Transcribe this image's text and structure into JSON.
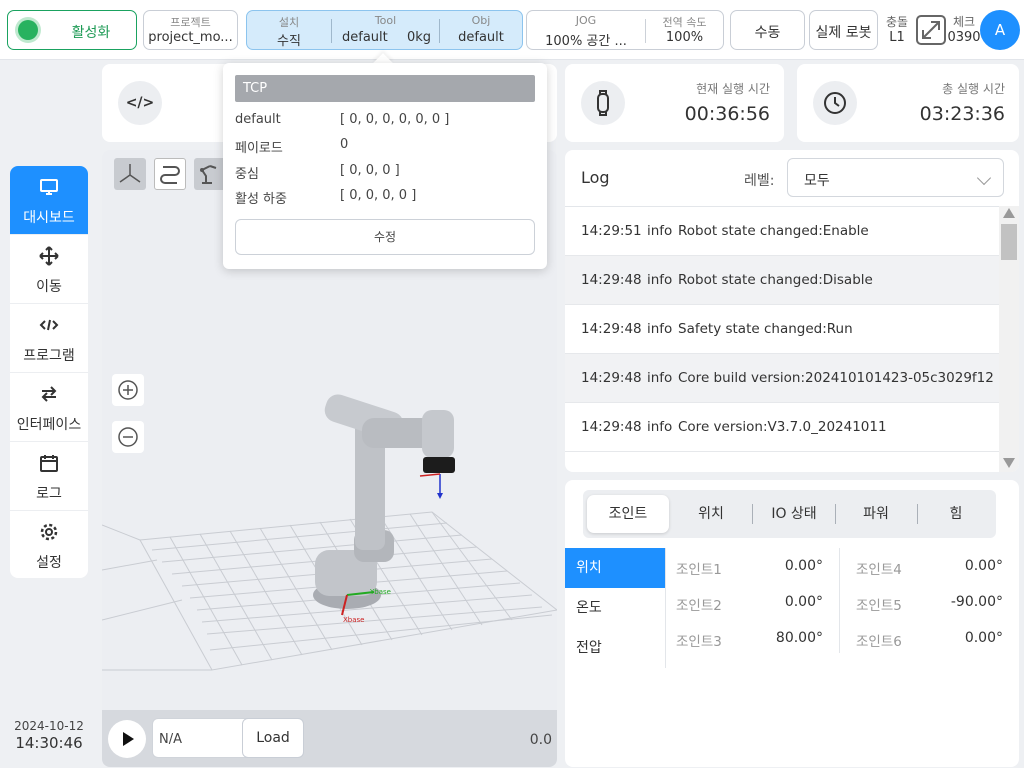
{
  "topbar": {
    "activate_label": "활성화",
    "project_label": "프로젝트",
    "project_value": "project_mo...",
    "install_label": "설치",
    "install_value": "수직",
    "tool_label": "Tool",
    "tool_value": "default",
    "tool_weight": "0kg",
    "obj_label": "Obj",
    "obj_value": "default",
    "jog_label": "JOG",
    "jog_value": "100%  공간 ...",
    "speed_label": "전역 속도",
    "speed_value": "100%",
    "manual_label": "수동",
    "real_robot_label": "실제 로봇",
    "collision_label": "충돌",
    "collision_value": "L1",
    "check_label": "체크",
    "check_value": "0390",
    "avatar_initial": "A"
  },
  "sidebar": {
    "items": [
      {
        "label": "대시보드",
        "icon": "monitor-icon",
        "active": true
      },
      {
        "label": "이동",
        "icon": "move-icon",
        "active": false
      },
      {
        "label": "프로그램",
        "icon": "code-icon",
        "active": false
      },
      {
        "label": "인터페이스",
        "icon": "swap-icon",
        "active": false
      },
      {
        "label": "로그",
        "icon": "calendar-icon",
        "active": false
      },
      {
        "label": "설정",
        "icon": "gear-icon",
        "active": false
      }
    ],
    "date": "2024-10-12",
    "time": "14:30:46"
  },
  "program": {
    "code_icon_text": "</>"
  },
  "tcp_popup": {
    "title": "TCP",
    "rows": [
      {
        "key": "default",
        "value": "[ 0, 0, 0, 0, 0, 0 ]"
      },
      {
        "key": "페이로드",
        "value": "0"
      },
      {
        "key": "중심",
        "value": "[ 0, 0, 0 ]"
      },
      {
        "key": "활성 하중",
        "value": "[ 0, 0, 0, 0 ]"
      }
    ],
    "edit_label": "수정"
  },
  "viewport": {
    "program_name": "N/A",
    "load_label": "Load",
    "speed_value": "0.0",
    "floor_axis_x": "Xbase",
    "floor_axis_y": "Ybase"
  },
  "times": {
    "current_label": "현재 실행 시간",
    "current_value": "00:36:56",
    "total_label": "총 실행 시간",
    "total_value": "03:23:36"
  },
  "log": {
    "title": "Log",
    "level_label": "레벨:",
    "level_value": "모두",
    "rows": [
      {
        "time": "14:29:51",
        "level": "info",
        "message": "Robot state changed:Enable"
      },
      {
        "time": "14:29:48",
        "level": "info",
        "message": "Robot state changed:Disable"
      },
      {
        "time": "14:29:48",
        "level": "info",
        "message": "Safety state changed:Run"
      },
      {
        "time": "14:29:48",
        "level": "info",
        "message": "Core build version:202410101423-05c3029f12"
      },
      {
        "time": "14:29:48",
        "level": "info",
        "message": "Core version:V3.7.0_20241011"
      }
    ]
  },
  "joints": {
    "tabs": [
      "조인트",
      "위치",
      "IO 상태",
      "파워",
      "힘"
    ],
    "active_tab": 0,
    "side_tabs": [
      "위치",
      "온도",
      "전압"
    ],
    "active_side_tab": 0,
    "items": [
      {
        "name": "조인트1",
        "value": "0.00°"
      },
      {
        "name": "조인트2",
        "value": "0.00°"
      },
      {
        "name": "조인트3",
        "value": "80.00°"
      },
      {
        "name": "조인트4",
        "value": "0.00°"
      },
      {
        "name": "조인트5",
        "value": "-90.00°"
      },
      {
        "name": "조인트6",
        "value": "0.00°"
      }
    ]
  },
  "colors": {
    "accent": "#1e90ff",
    "active_green": "#27b25f",
    "install_bg": "#d5ebfb"
  }
}
